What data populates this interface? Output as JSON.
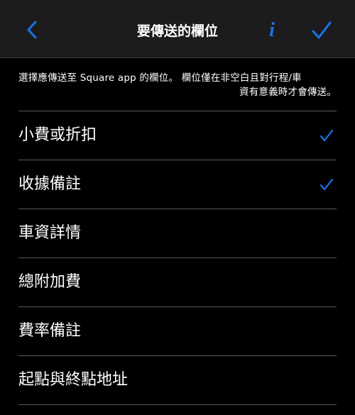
{
  "nav": {
    "title": "要傳送的欄位",
    "back_icon": "chevron-left-icon",
    "info_icon": "info-icon",
    "done_icon": "checkmark-icon"
  },
  "description": {
    "line1": "選擇應傳送至 Square app 的欄位。 欄位僅在非空白且對行程/車",
    "line2": "資有意義時才會傳送。"
  },
  "fields": [
    {
      "label": "小費或折扣",
      "checked": true
    },
    {
      "label": "收據備註",
      "checked": true
    },
    {
      "label": "車資詳情",
      "checked": false
    },
    {
      "label": "總附加費",
      "checked": false
    },
    {
      "label": "費率備註",
      "checked": false
    },
    {
      "label": "起點與終點地址",
      "checked": false
    }
  ],
  "colors": {
    "accent": "#1a73e8",
    "background": "#000000",
    "navbar": "#1c1c1e",
    "separator": "#5a5a5e"
  }
}
